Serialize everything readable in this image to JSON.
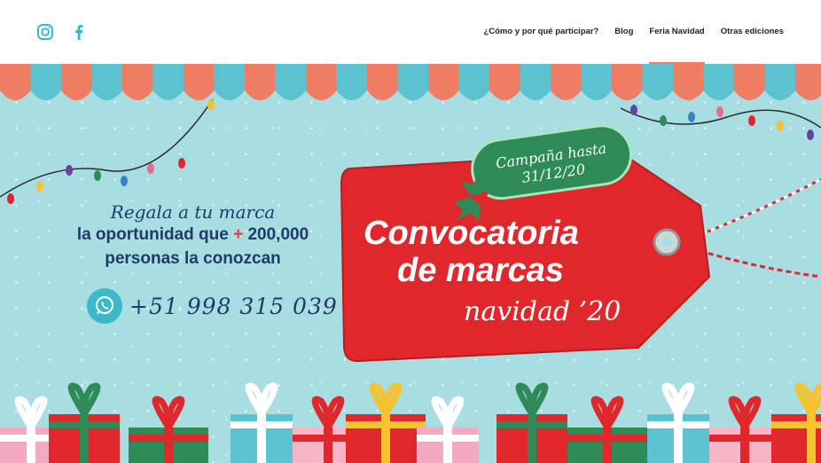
{
  "header": {
    "nav": [
      {
        "label": "¿Cómo y por qué participar?"
      },
      {
        "label": "Blog"
      },
      {
        "label": "Feria Navidad"
      },
      {
        "label": "Otras ediciones"
      }
    ],
    "social_icons": [
      "instagram-icon",
      "facebook-icon"
    ]
  },
  "hero": {
    "tagline_script": "Regala a tu marca",
    "tagline_line2_a": "la oportunidad que ",
    "tagline_plus": "+",
    "tagline_line2_b": " 200,000",
    "tagline_line3": "personas la conozcan",
    "phone": "+51 998 315 039",
    "tag_line1": "Convocatoria",
    "tag_line2": "de marcas",
    "tag_line3": "navidad ’20",
    "badge_line1": "Campaña hasta",
    "badge_line2": "31/12/20"
  },
  "colors": {
    "awning_orange": "#ef7d63",
    "awning_blue": "#5bc3cf",
    "hero_bg": "#a8dde2",
    "tag_red": "#e0282c",
    "badge_green": "#2e8b57",
    "text_navy": "#1f3a6b",
    "whatsapp_teal": "#3bb9c8"
  }
}
